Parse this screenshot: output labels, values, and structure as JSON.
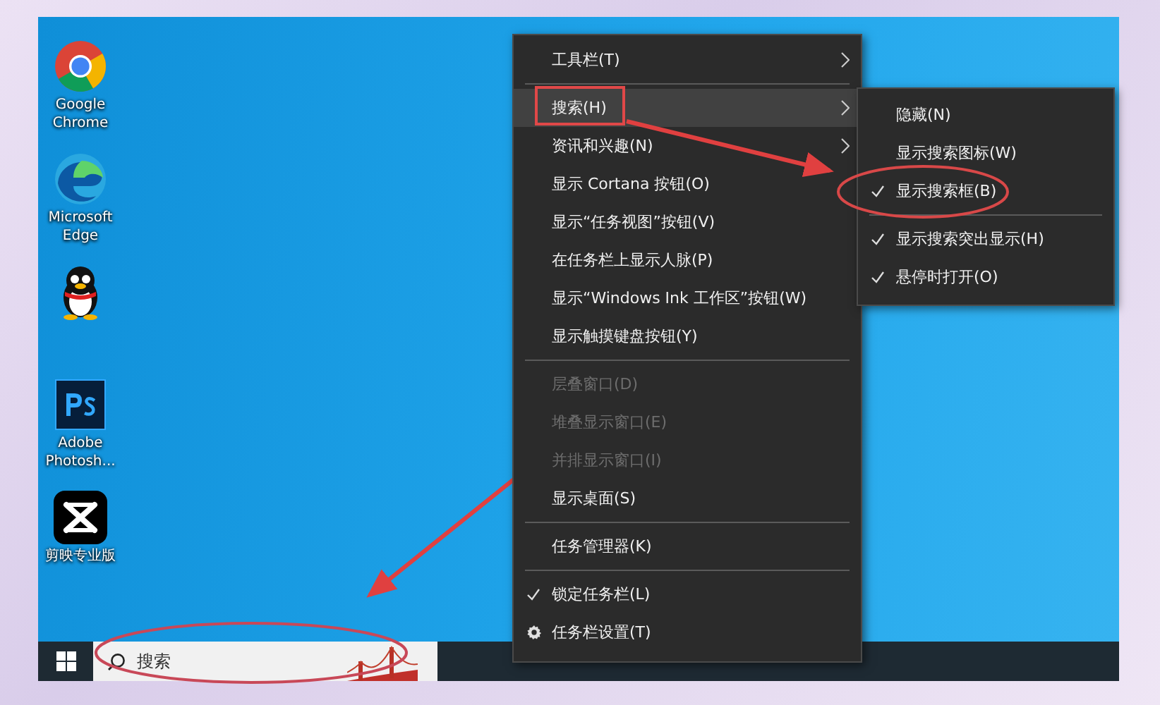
{
  "desktop_icons": [
    {
      "kind": "chrome",
      "label": "Google Chrome"
    },
    {
      "kind": "edge",
      "label": "Microsoft Edge"
    },
    {
      "kind": "qq"
    },
    {
      "kind": "photoshop",
      "label": "Adobe Photosh..."
    },
    {
      "kind": "capcut",
      "label": "剪映专业版"
    }
  ],
  "context_menu": {
    "items": [
      {
        "kind": "item",
        "label": "工具栏(T)",
        "submenu": true,
        "selected": false,
        "checked": false,
        "disabled": false
      },
      {
        "kind": "separator"
      },
      {
        "kind": "item",
        "label": "搜索(H)",
        "submenu": true,
        "selected": true,
        "checked": false,
        "disabled": false
      },
      {
        "kind": "item",
        "label": "资讯和兴趣(N)",
        "submenu": true,
        "selected": false,
        "checked": false,
        "disabled": false
      },
      {
        "kind": "item",
        "label": "显示 Cortana 按钮(O)",
        "submenu": false,
        "selected": false,
        "checked": false,
        "disabled": false
      },
      {
        "kind": "item",
        "label": "显示“任务视图”按钮(V)",
        "submenu": false,
        "selected": false,
        "checked": false,
        "disabled": false
      },
      {
        "kind": "item",
        "label": "在任务栏上显示人脉(P)",
        "submenu": false,
        "selected": false,
        "checked": false,
        "disabled": false
      },
      {
        "kind": "item",
        "label": "显示“Windows Ink 工作区”按钮(W)",
        "submenu": false,
        "selected": false,
        "checked": false,
        "disabled": false
      },
      {
        "kind": "item",
        "label": "显示触摸键盘按钮(Y)",
        "submenu": false,
        "selected": false,
        "checked": false,
        "disabled": false
      },
      {
        "kind": "separator"
      },
      {
        "kind": "item",
        "label": "层叠窗口(D)",
        "submenu": false,
        "selected": false,
        "checked": false,
        "disabled": true
      },
      {
        "kind": "item",
        "label": "堆叠显示窗口(E)",
        "submenu": false,
        "selected": false,
        "checked": false,
        "disabled": true
      },
      {
        "kind": "item",
        "label": "并排显示窗口(I)",
        "submenu": false,
        "selected": false,
        "checked": false,
        "disabled": true
      },
      {
        "kind": "item",
        "label": "显示桌面(S)",
        "submenu": false,
        "selected": false,
        "checked": false,
        "disabled": false
      },
      {
        "kind": "separator"
      },
      {
        "kind": "item",
        "label": "任务管理器(K)",
        "submenu": false,
        "selected": false,
        "checked": false,
        "disabled": false
      },
      {
        "kind": "separator"
      },
      {
        "kind": "item",
        "label": "锁定任务栏(L)",
        "submenu": false,
        "selected": false,
        "checked": true,
        "disabled": false
      },
      {
        "kind": "settings",
        "label": "任务栏设置(T)",
        "submenu": false,
        "selected": false,
        "checked": false,
        "disabled": false
      }
    ]
  },
  "search_submenu": {
    "items": [
      {
        "kind": "item",
        "label": "隐藏(N)",
        "submenu": false,
        "selected": false,
        "checked": false,
        "disabled": false
      },
      {
        "kind": "item",
        "label": "显示搜索图标(W)",
        "submenu": false,
        "selected": false,
        "checked": false,
        "disabled": false
      },
      {
        "kind": "item",
        "label": "显示搜索框(B)",
        "submenu": false,
        "selected": false,
        "checked": true,
        "disabled": false
      },
      {
        "kind": "separator"
      },
      {
        "kind": "item",
        "label": "显示搜索突出显示(H)",
        "submenu": false,
        "selected": false,
        "checked": true,
        "disabled": false
      },
      {
        "kind": "item",
        "label": "悬停时打开(O)",
        "submenu": false,
        "selected": false,
        "checked": true,
        "disabled": false
      }
    ]
  },
  "taskbar": {
    "search": {
      "placeholder": "搜索"
    }
  }
}
